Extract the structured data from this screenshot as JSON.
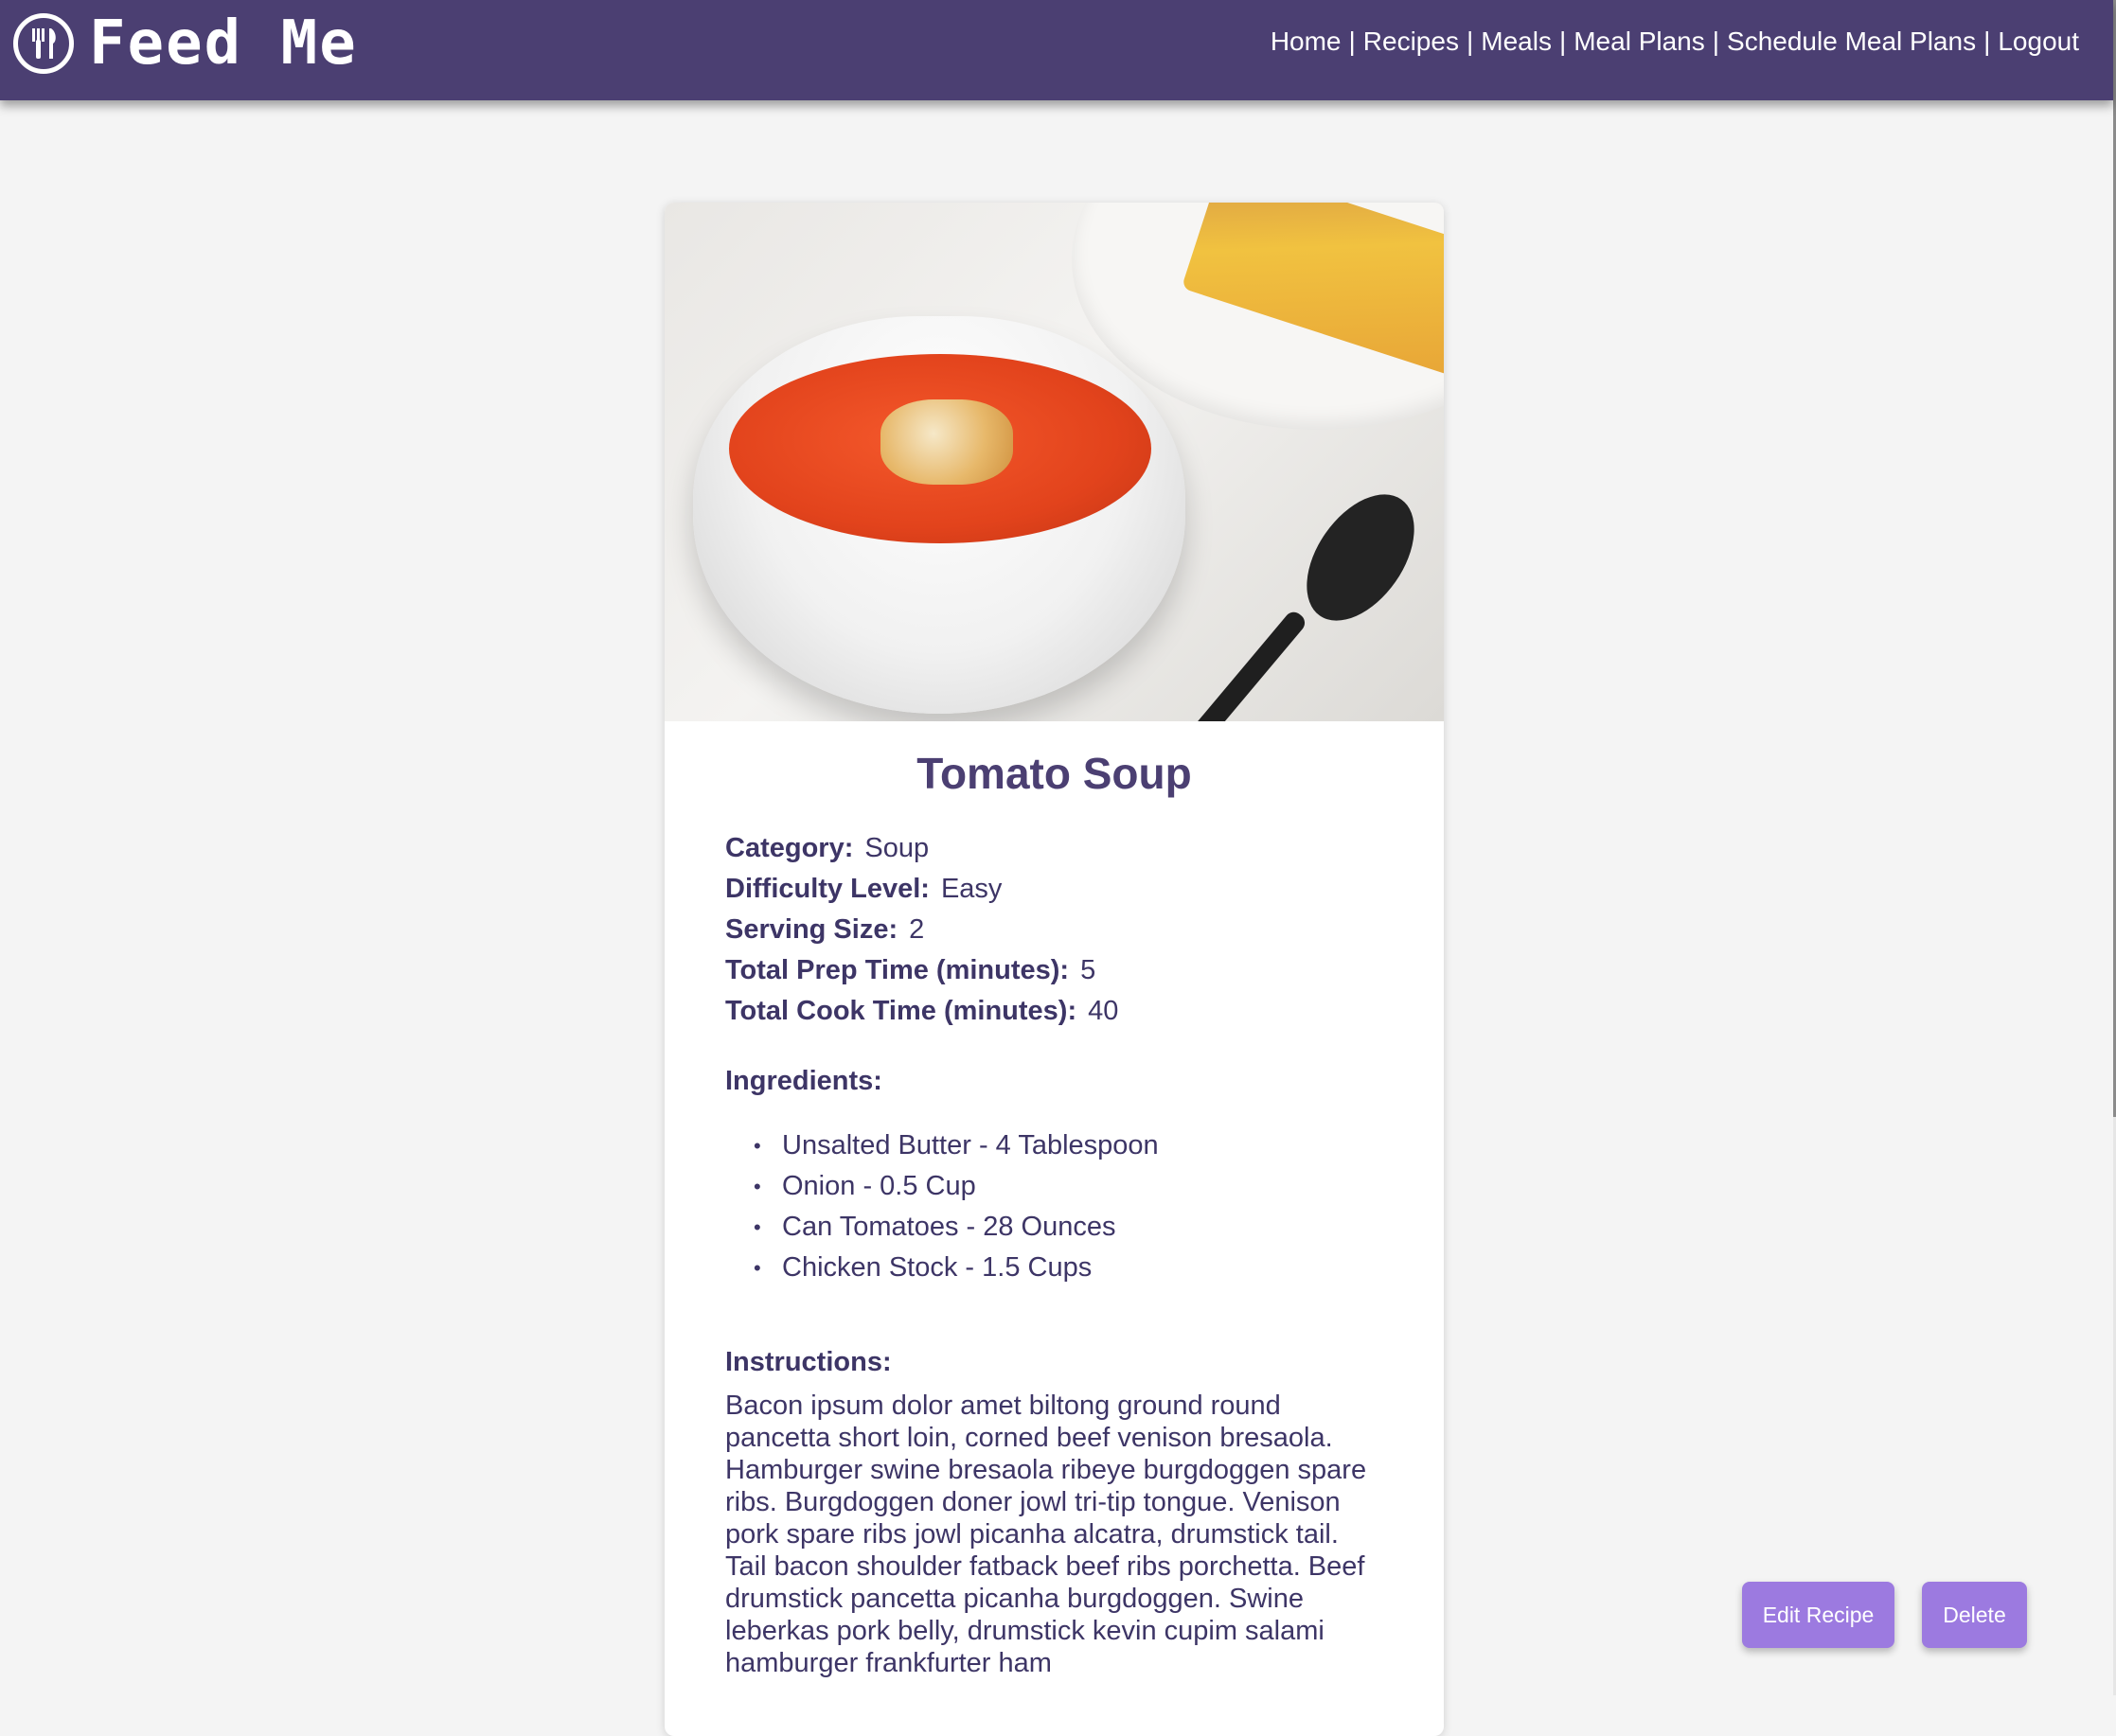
{
  "brand": {
    "name": "Feed Me",
    "logo_icon": "fork-knife-plate-icon"
  },
  "nav": {
    "links": [
      "Home",
      "Recipes",
      "Meals",
      "Meal Plans",
      "Schedule Meal Plans",
      "Logout"
    ],
    "separator": "|"
  },
  "recipe": {
    "image_alt": "Tomato soup with croutons and grilled cheese sandwich",
    "title": "Tomato Soup",
    "details": [
      {
        "label": "Category:",
        "value": "Soup"
      },
      {
        "label": "Difficulty Level:",
        "value": "Easy"
      },
      {
        "label": "Serving Size:",
        "value": "2"
      },
      {
        "label": "Total Prep Time (minutes):",
        "value": "5"
      },
      {
        "label": "Total Cook Time (minutes):",
        "value": "40"
      }
    ],
    "ingredients_heading": "Ingredients:",
    "ingredients": [
      "Unsalted Butter - 4 Tablespoon",
      "Onion - 0.5 Cup",
      "Can Tomatoes - 28 Ounces",
      "Chicken Stock - 1.5 Cups"
    ],
    "instructions_heading": "Instructions:",
    "instructions": "Bacon ipsum dolor amet biltong ground round pancetta short loin, corned beef venison bresaola. Hamburger swine bresaola ribeye burgdoggen spare ribs. Burgdoggen doner jowl tri-tip tongue. Venison pork spare ribs jowl picanha alcatra, drumstick tail. Tail bacon shoulder fatback beef ribs porchetta. Beef drumstick pancetta picanha burgdoggen. Swine leberkas pork belly, drumstick kevin cupim salami hamburger frankfurter ham"
  },
  "actions": {
    "edit_label": "Edit Recipe",
    "delete_label": "Delete"
  },
  "colors": {
    "navbar": "#4b3f72",
    "text": "#3d3566",
    "button": "#9c7ae0",
    "background": "#f4f4f4"
  }
}
